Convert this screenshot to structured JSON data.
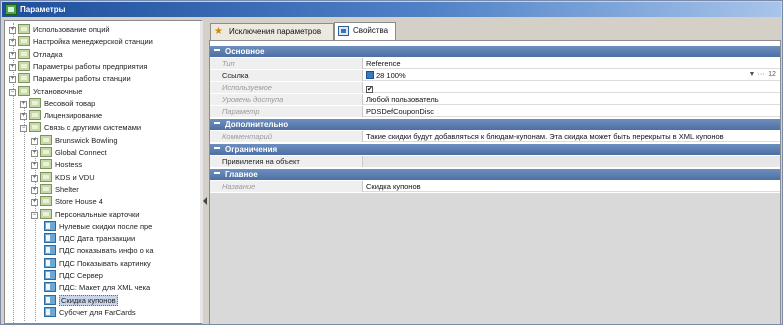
{
  "window": {
    "title": "Параметры"
  },
  "tree": {
    "items": [
      {
        "label": "Использование опций",
        "exp": "+",
        "type": "folder",
        "indent": 0
      },
      {
        "label": "Настройка менеджерской станции",
        "exp": "+",
        "type": "folder",
        "indent": 0
      },
      {
        "label": "Отладка",
        "exp": "+",
        "type": "folder",
        "indent": 0
      },
      {
        "label": "Параметры работы предприятия",
        "exp": "+",
        "type": "folder",
        "indent": 0
      },
      {
        "label": "Параметры работы станции",
        "exp": "+",
        "type": "folder",
        "indent": 0
      },
      {
        "label": "Установочные",
        "exp": "−",
        "type": "folder",
        "indent": 0
      },
      {
        "label": "Весовой товар",
        "exp": "+",
        "type": "folder",
        "indent": 1
      },
      {
        "label": "Лицензирование",
        "exp": "+",
        "type": "folder",
        "indent": 1
      },
      {
        "label": "Связь с другими системами",
        "exp": "−",
        "type": "folder",
        "indent": 1
      },
      {
        "label": "Brunswick Bowling",
        "exp": "+",
        "type": "folder",
        "indent": 2
      },
      {
        "label": "Global Connect",
        "exp": "+",
        "type": "folder",
        "indent": 2
      },
      {
        "label": "Hostess",
        "exp": "+",
        "type": "folder",
        "indent": 2
      },
      {
        "label": "KDS и VDU",
        "exp": "+",
        "type": "folder",
        "indent": 2
      },
      {
        "label": "Shelter",
        "exp": "+",
        "type": "folder",
        "indent": 2
      },
      {
        "label": "Store House 4",
        "exp": "+",
        "type": "folder",
        "indent": 2
      },
      {
        "label": "Персональные карточки",
        "exp": "−",
        "type": "folder",
        "indent": 2
      },
      {
        "label": "Нулевые скидки после пре",
        "exp": "",
        "type": "leaf",
        "indent": 3
      },
      {
        "label": "ПДС Дата транзакции",
        "exp": "",
        "type": "leaf",
        "indent": 3
      },
      {
        "label": "ПДС показывать инфо о ка",
        "exp": "",
        "type": "leaf",
        "indent": 3
      },
      {
        "label": "ПДС Показывать картинку",
        "exp": "",
        "type": "leaf",
        "indent": 3
      },
      {
        "label": "ПДС Сервер",
        "exp": "",
        "type": "leaf",
        "indent": 3
      },
      {
        "label": "ПДС: Макет для XML чека",
        "exp": "",
        "type": "leaf",
        "indent": 3
      },
      {
        "label": "Скидка купонов",
        "exp": "",
        "type": "leaf",
        "indent": 3,
        "selected": true
      },
      {
        "label": "Субсчет для FarCards",
        "exp": "",
        "type": "leaf",
        "indent": 3
      }
    ]
  },
  "tabs": [
    {
      "label": "Исключения параметров",
      "icon": "star-icon"
    },
    {
      "label": "Свойства",
      "icon": "properties-icon",
      "active": true
    }
  ],
  "properties": {
    "sections": {
      "main": "Основное",
      "extra": "Дополнительно",
      "limits": "Ограничения",
      "general": "Главное"
    },
    "rows": {
      "type_name": "Тип",
      "type_value": "Reference",
      "link_name": "Ссылка",
      "link_value": "28 100%",
      "link_ctrl_value": "12",
      "used_name": "Используемое",
      "used_value": "✔",
      "access_name": "Уровень доступа",
      "access_value": "Любой пользователь",
      "param_name": "Параметр",
      "param_value": "PDSDefCouponDisc",
      "comment_name": "Комментарий",
      "comment_value": "Такие скидки будут добавляться к блюдам-купонам. Эта скидка может быть перекрыты в XML купонов",
      "binding_name": "Привилегия на объект",
      "binding_value": "",
      "title_name": "Название",
      "title_value": "Скидка купонов"
    }
  }
}
